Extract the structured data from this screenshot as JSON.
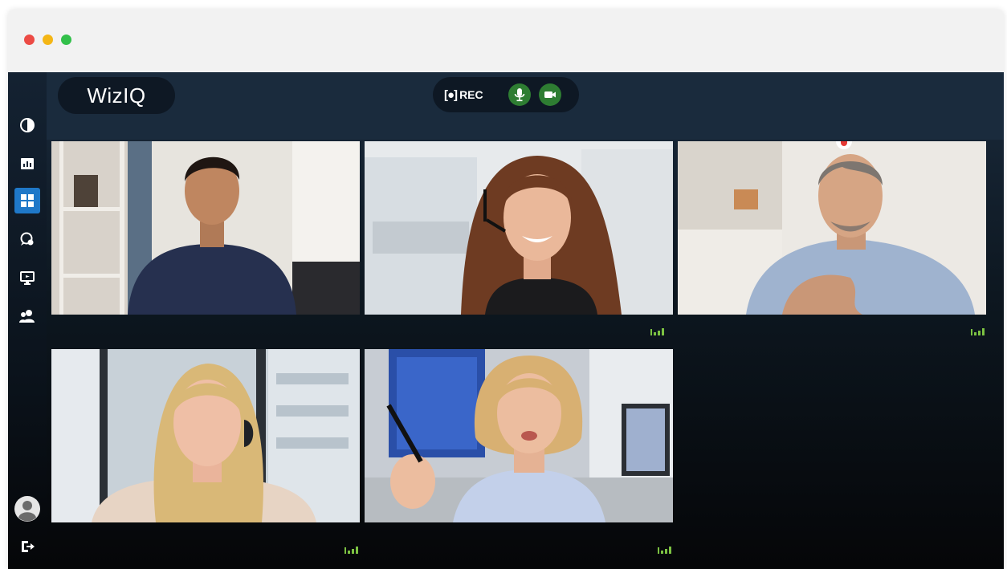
{
  "app": {
    "name": "WizIQ"
  },
  "window_controls": [
    "close",
    "minimize",
    "maximize"
  ],
  "sidebar": {
    "items": [
      {
        "icon": "pie-chart-icon",
        "active": false
      },
      {
        "icon": "whiteboard-icon",
        "active": false
      },
      {
        "icon": "grid-view-icon",
        "active": true
      },
      {
        "icon": "chat-icon",
        "active": false
      },
      {
        "icon": "screen-share-icon",
        "active": false
      },
      {
        "icon": "participants-icon",
        "active": false
      }
    ],
    "bottom": [
      {
        "icon": "user-avatar-icon"
      },
      {
        "icon": "exit-icon"
      }
    ]
  },
  "controls": {
    "record_bracket": "[●]",
    "record_label": "REC",
    "mic_icon": "microphone-icon",
    "camera_icon": "video-camera-icon"
  },
  "participants": [
    {
      "id": "p1",
      "signal": "signal-strength-icon",
      "speaking": false
    },
    {
      "id": "p2",
      "signal": "signal-strength-icon",
      "speaking": false
    },
    {
      "id": "p3",
      "signal": "signal-strength-icon",
      "speaking": true
    },
    {
      "id": "p4",
      "signal": "signal-strength-icon",
      "speaking": false
    },
    {
      "id": "p5",
      "signal": "signal-strength-icon",
      "speaking": false
    }
  ],
  "colors": {
    "accent": "#1f78c8",
    "record_green": "#2e7d32",
    "signal_green": "#7cc242",
    "speaking_red": "#e53935"
  }
}
